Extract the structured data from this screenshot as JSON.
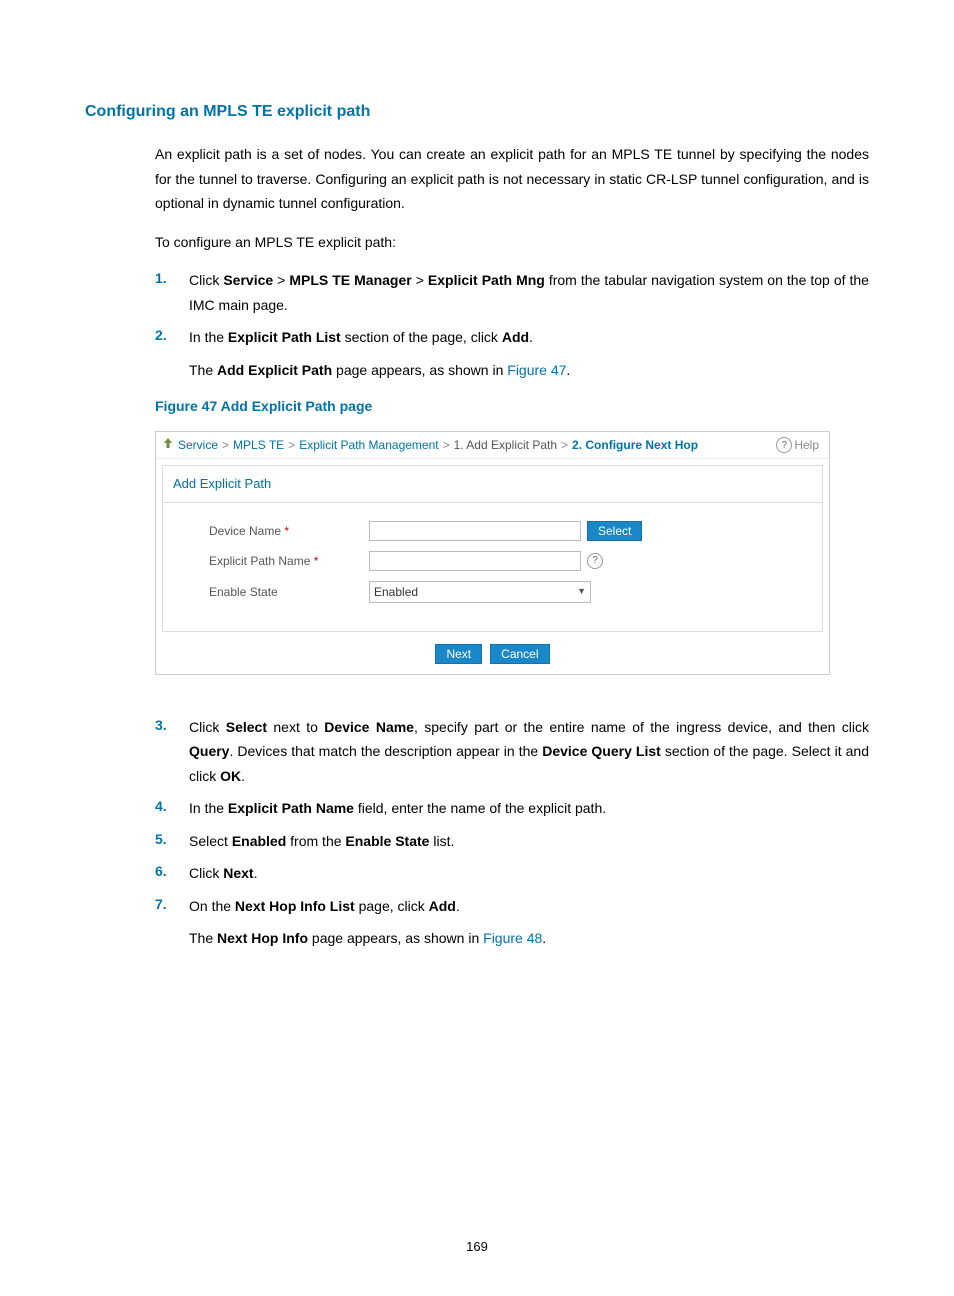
{
  "heading": "Configuring an MPLS TE explicit path",
  "intro": "An explicit path is a set of nodes. You can create an explicit path for an MPLS TE tunnel by specifying the nodes for the tunnel to traverse. Configuring an explicit path is not necessary in static CR-LSP tunnel configuration, and is optional in dynamic tunnel configuration.",
  "lead": "To configure an MPLS TE explicit path:",
  "steps": {
    "s1": {
      "num": "1.",
      "pre": "Click ",
      "b1": "Service",
      "gt1": " > ",
      "b2": "MPLS TE Manager",
      "gt2": " > ",
      "b3": "Explicit Path Mng",
      "post": " from the tabular navigation system on the top of the IMC main page."
    },
    "s2": {
      "num": "2.",
      "pre": "In the ",
      "b1": "Explicit Path List",
      "mid": " section of the page, click ",
      "b2": "Add",
      "post": "."
    },
    "s2sub": {
      "pre": "The ",
      "b1": "Add Explicit Path",
      "mid": " page appears, as shown in ",
      "link": "Figure 47",
      "post": "."
    },
    "s3": {
      "num": "3.",
      "pre": "Click ",
      "b1": "Select",
      "t1": " next to ",
      "b2": "Device Name",
      "t2": ", specify part or the entire name of the ingress device, and then click ",
      "b3": "Query",
      "t3": ". Devices that match the description appear in the ",
      "b4": "Device Query List",
      "t4": " section of the page. Select it and click ",
      "b5": "OK",
      "post": "."
    },
    "s4": {
      "num": "4.",
      "pre": "In the ",
      "b1": "Explicit Path Name",
      "post": " field, enter the name of the explicit path."
    },
    "s5": {
      "num": "5.",
      "pre": "Select ",
      "b1": "Enabled",
      "mid": " from the ",
      "b2": "Enable State",
      "post": " list."
    },
    "s6": {
      "num": "6.",
      "pre": "Click ",
      "b1": "Next",
      "post": "."
    },
    "s7": {
      "num": "7.",
      "pre": "On the ",
      "b1": "Next Hop Info List",
      "mid": " page, click ",
      "b2": "Add",
      "post": "."
    },
    "s7sub": {
      "pre": "The ",
      "b1": "Next Hop Info",
      "mid": " page appears, as shown in ",
      "link": "Figure 48",
      "post": "."
    }
  },
  "figcaption": "Figure 47 Add Explicit Path page",
  "shot": {
    "bc": {
      "service": "Service",
      "mpls": "MPLS TE",
      "epm": "Explicit Path Management",
      "step1": "1. Add Explicit Path",
      "step2": "2. Configure Next Hop",
      "sep": ">"
    },
    "help": "Help",
    "panel_title": "Add Explicit Path",
    "labels": {
      "device": "Device Name",
      "path": "Explicit Path Name",
      "state": "Enable State",
      "star": "*"
    },
    "state_value": "Enabled",
    "btn_select": "Select",
    "btn_next": "Next",
    "btn_cancel": "Cancel",
    "q": "?"
  },
  "pagenum": "169"
}
